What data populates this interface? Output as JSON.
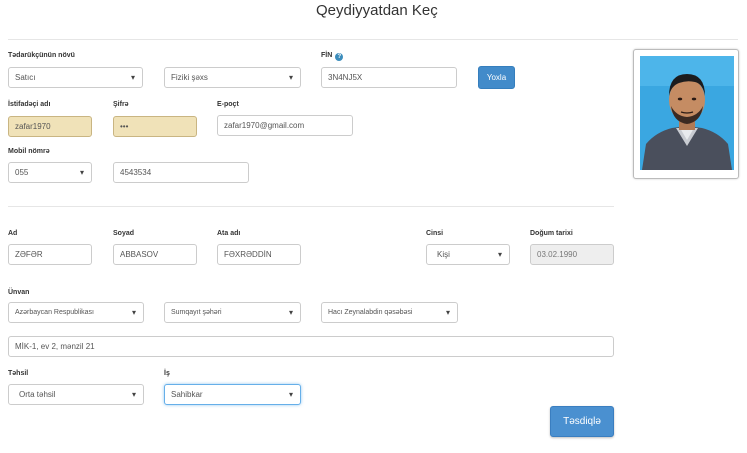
{
  "page_title": "Qeydiyyatdan Keç",
  "supplier_type": {
    "label": "Tədarükçünün növü",
    "value": "Satıcı"
  },
  "person_type": {
    "value": "Fiziki şəxs"
  },
  "fin": {
    "label": "FİN",
    "value": "3N4NJ5X",
    "help_icon": "?"
  },
  "check_button": "Yoxla",
  "username": {
    "label": "İstifadəçi adı",
    "value": "zafar1970"
  },
  "password": {
    "label": "Şifrə",
    "value": "•••"
  },
  "email": {
    "label": "E-poçt",
    "value": "zafar1970@gmail.com"
  },
  "mobile": {
    "label": "Mobil nömrə",
    "prefix": "055",
    "number": "4543534"
  },
  "first_name": {
    "label": "Ad",
    "value": "ZƏFƏR"
  },
  "last_name": {
    "label": "Soyad",
    "value": "ABBASOV"
  },
  "father_name": {
    "label": "Ata adı",
    "value": "FƏXRƏDDİN"
  },
  "gender": {
    "label": "Cinsi",
    "value": "Kişi"
  },
  "birth_date": {
    "label": "Doğum tarixi",
    "value": "03.02.1990"
  },
  "address": {
    "label": "Ünvan",
    "country": "Azərbaycan Respublikası",
    "city": "Sumqayıt şəhəri",
    "settlement": "Hacı Zeynalabdin qəsəbəsi",
    "street": "MİK-1, ev 2, mənzil 21"
  },
  "education": {
    "label": "Təhsil",
    "value": "Orta təhsil"
  },
  "job": {
    "label": "İş",
    "value": "Sahibkar"
  },
  "submit_button": "Təsdiqlə",
  "colors": {
    "primary": "#428bca",
    "readonly_yellow": "#f0e2b8",
    "disabled_gray": "#eeeeee"
  }
}
